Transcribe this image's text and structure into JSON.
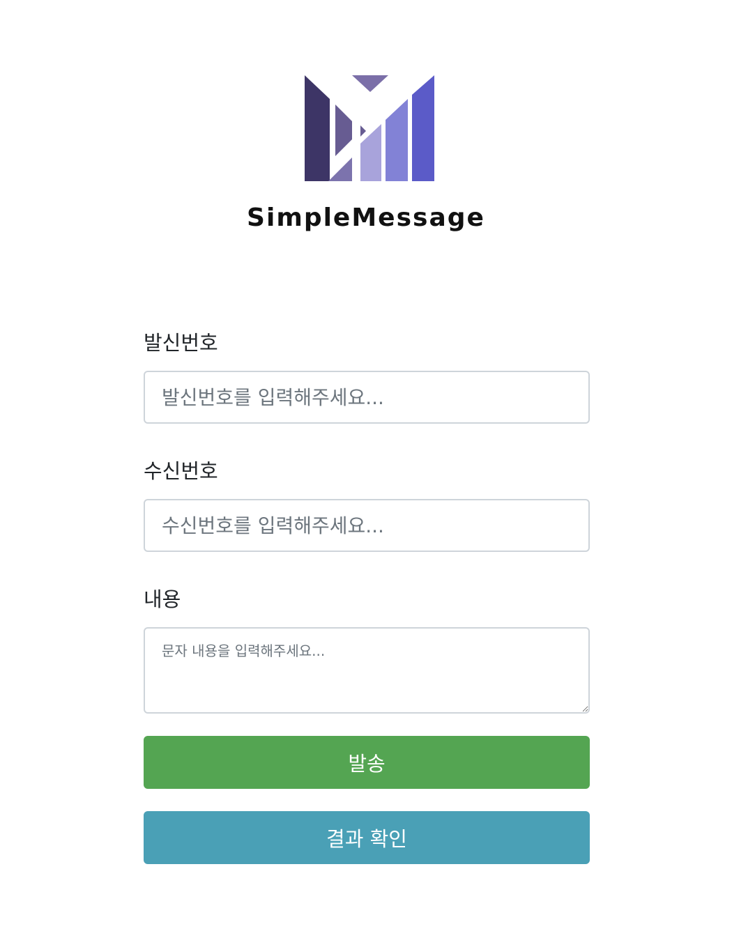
{
  "logo": {
    "text": "SimpleMessage",
    "colors": {
      "dark": "#3d3566",
      "mid": "#675c92",
      "light": "#a8a3db",
      "blue": "#8282d6",
      "brand": "#5b5bc8"
    }
  },
  "form": {
    "sender": {
      "label": "발신번호",
      "placeholder": "발신번호를 입력해주세요...",
      "value": ""
    },
    "receiver": {
      "label": "수신번호",
      "placeholder": "수신번호를 입력해주세요...",
      "value": ""
    },
    "content": {
      "label": "내용",
      "placeholder": "문자 내용을 입력해주세요...",
      "value": ""
    }
  },
  "buttons": {
    "send_label": "발송",
    "result_label": "결과 확인",
    "send_color": "#54a552",
    "result_color": "#4aa0b6"
  }
}
